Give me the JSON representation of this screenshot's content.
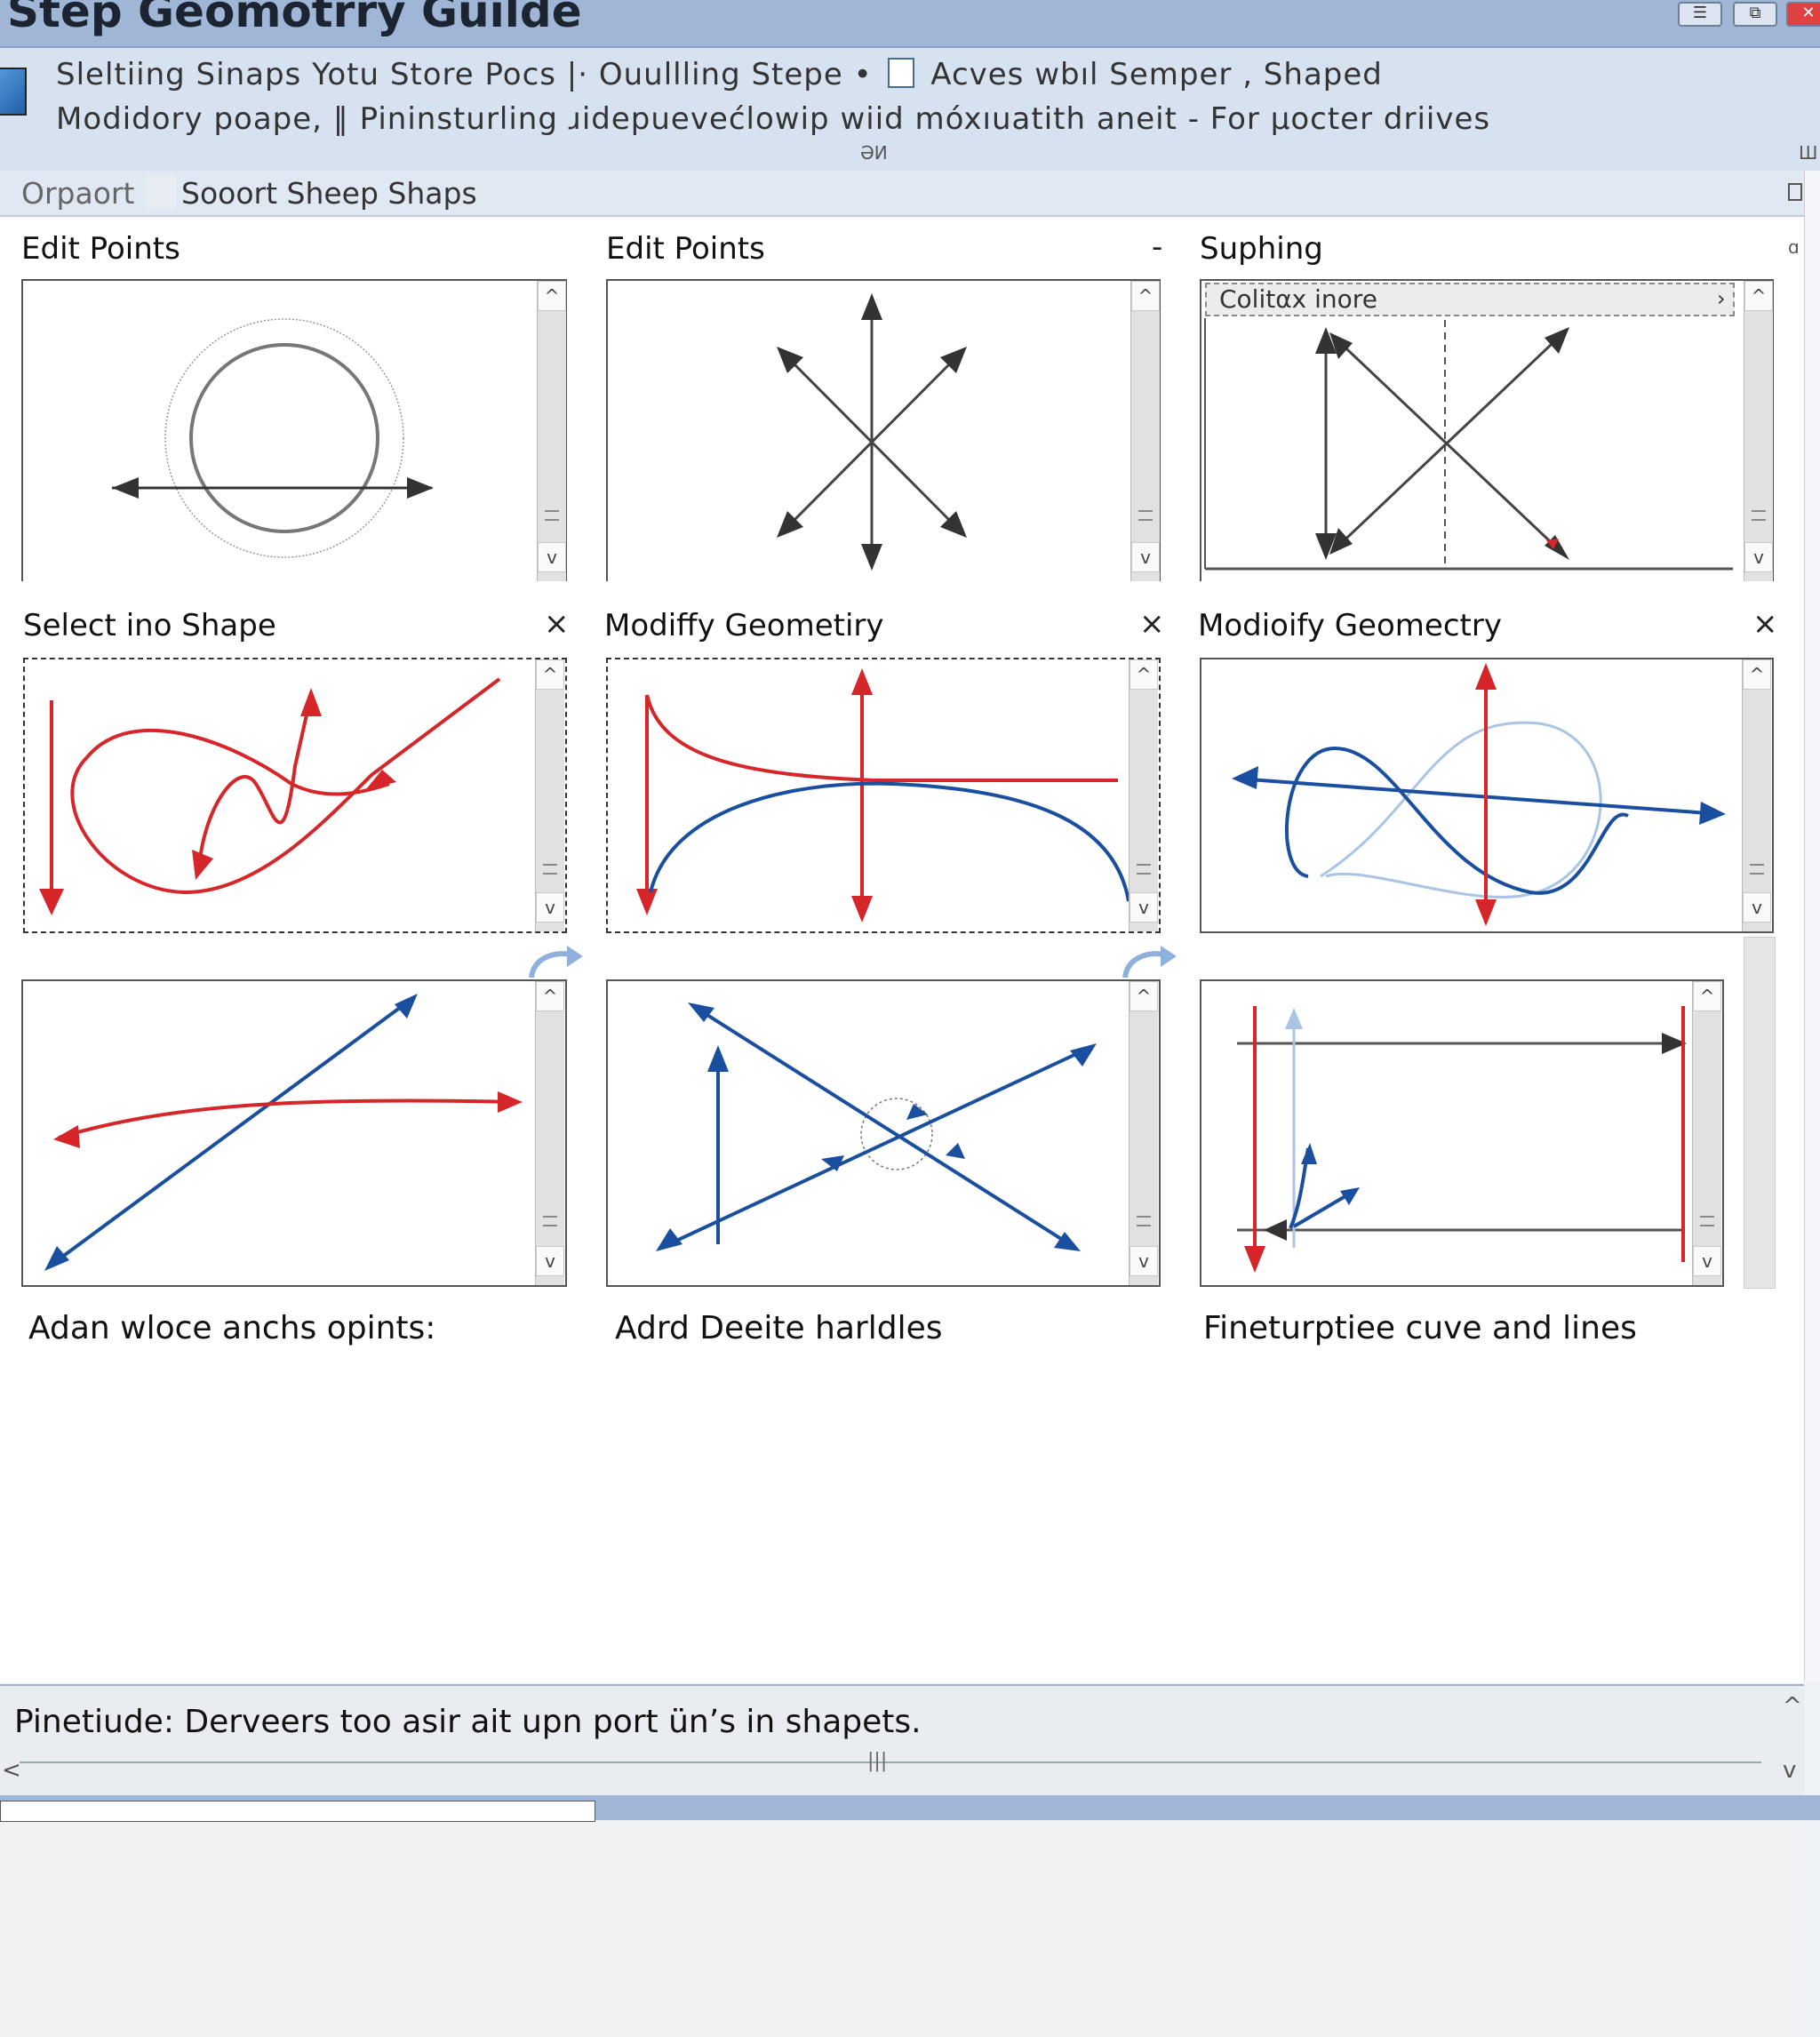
{
  "window": {
    "title": "Step Geomotrry Guilde",
    "buttons": [
      "☰",
      "⧉",
      "✕"
    ]
  },
  "infobar": {
    "line1_a": "Sleltiing  Sinaps Yotu  Store Pocs",
    "line1_sep": "|·",
    "line1_b": "Ouullling Stepe •",
    "line1_c": "Acves  wbıl  Semper ,  Shaped",
    "line2": "Modidory poape, ‖ Pininsturling  ɹidepuevećlowip  wiid  móxıuatith  aneit - For  µocter  driives",
    "center_mark": "ƏИ",
    "right_mark": "Ш"
  },
  "tabs": {
    "first": "Orpaort",
    "second": "Sooort Sheep Shaps"
  },
  "panels": [
    {
      "title": "Edit Points",
      "close": ""
    },
    {
      "title": "Edit Points",
      "close": "-"
    },
    {
      "title": "Suphing",
      "close": "",
      "inner_bar": "Colitαx inore",
      "corner": "ɑ"
    },
    {
      "title": "Select ino Shape",
      "close": "×"
    },
    {
      "title": "Modiffy Geometiry",
      "close": "×"
    },
    {
      "title": "Modioify Geomectry",
      "close": "×"
    }
  ],
  "captions": [
    "Adan wloce anchs opints:",
    "Adrd Deeite harldles",
    "Fineturptiee cuve and lines"
  ],
  "status": {
    "text": "Pinetiude: Derveers too asir ait upn port ün’s in shapets."
  },
  "scrollbar": {
    "up": "^",
    "down": "v",
    "left": "<",
    "grip": "|||"
  },
  "colors": {
    "titlebar": "#9fb6d6",
    "red": "#d6262a",
    "blue": "#1a4fa0",
    "light_blue": "#a9c4e4",
    "dark": "#333333"
  }
}
